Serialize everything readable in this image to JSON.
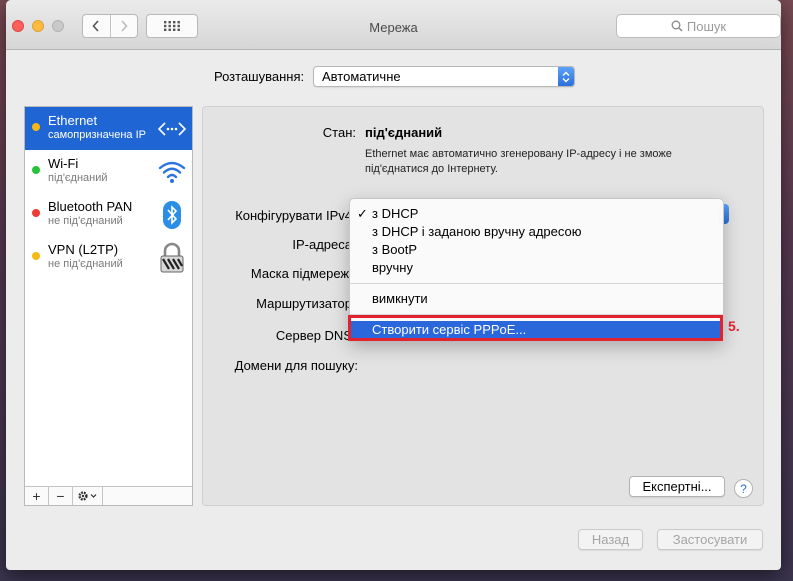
{
  "window": {
    "title": "Мережа"
  },
  "search": {
    "placeholder": "Пошук"
  },
  "location": {
    "label": "Розташування:",
    "value": "Автоматичне"
  },
  "services": [
    {
      "name": "Ethernet",
      "status": "самопризначена IP",
      "dot_color": "#f5b814",
      "icon": "ethernet-arrows-icon",
      "selected": true
    },
    {
      "name": "Wi-Fi",
      "status": "під'єднаний",
      "dot_color": "#27c13a",
      "icon": "wifi-icon",
      "selected": false
    },
    {
      "name": "Bluetooth PAN",
      "status": "не під'єднаний",
      "dot_color": "#ee3b36",
      "icon": "bluetooth-icon",
      "selected": false
    },
    {
      "name": "VPN (L2TP)",
      "status": "не під'єднаний",
      "dot_color": "#f5b814",
      "icon": "lock-icon",
      "selected": false
    }
  ],
  "sidebar_controls": {
    "add": "+",
    "remove": "−"
  },
  "detail": {
    "status_label": "Стан:",
    "status_value": "під'єднаний",
    "status_description": "Ethernet має автоматично згенеровану IP-адресу і не зможе під'єднатися до Інтернету.",
    "configure_label": "Конфігурувати IPv4",
    "ip_label": "IP-адреса",
    "subnet_label": "Маска підмережі",
    "router_label": "Маршрутизатор",
    "dns_label": "Сервер DNS",
    "search_domains_label": "Домени для пошуку:"
  },
  "ipv4_menu": {
    "checkmark": "✓",
    "items": [
      "з DHCP",
      "з DHCP і заданою вручну адресою",
      "з BootP",
      "вручну"
    ],
    "off": "вимкнути",
    "highlighted": "Створити сервіс PPPoE..."
  },
  "annotation": {
    "step": "5."
  },
  "buttons": {
    "advanced": "Експертні...",
    "help": "?",
    "revert": "Назад",
    "apply": "Застосувати"
  },
  "colors": {
    "accent": "#1f66d4",
    "annotation_red": "#e0232f"
  }
}
